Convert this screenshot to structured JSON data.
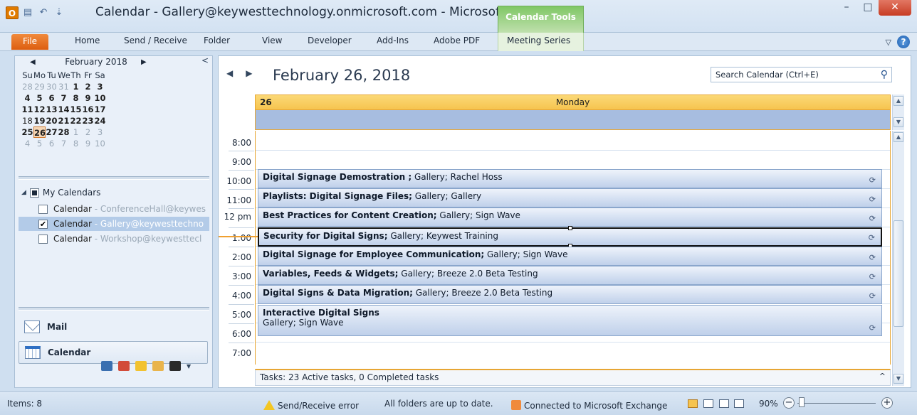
{
  "window": {
    "title": "Calendar - Gallery@keywesttechnology.onmicrosoft.com - Microsof...",
    "context_tab": "Calendar Tools",
    "controls": {
      "minimize": "–",
      "maximize": "□",
      "close": "✕"
    }
  },
  "ribbon": {
    "file": "File",
    "tabs": [
      "Home",
      "Send / Receive",
      "Folder",
      "View",
      "Developer",
      "Add-Ins",
      "Adobe PDF",
      "Meeting Series"
    ]
  },
  "minical": {
    "month_label": "February 2018",
    "weekdays": [
      "Su",
      "Mo",
      "Tu",
      "We",
      "Th",
      "Fr",
      "Sa"
    ],
    "weeks": [
      [
        "28",
        "29",
        "30",
        "31",
        "1",
        "2",
        "3"
      ],
      [
        "4",
        "5",
        "6",
        "7",
        "8",
        "9",
        "10"
      ],
      [
        "11",
        "12",
        "13",
        "14",
        "15",
        "16",
        "17"
      ],
      [
        "18",
        "19",
        "20",
        "21",
        "22",
        "23",
        "24"
      ],
      [
        "25",
        "26",
        "27",
        "28",
        "1",
        "2",
        "3"
      ],
      [
        "4",
        "5",
        "6",
        "7",
        "8",
        "9",
        "10"
      ]
    ],
    "today": "26"
  },
  "my_calendars": {
    "group_label": "My Calendars",
    "items": [
      {
        "name": "Calendar",
        "owner": " - ConferenceHall@keywes",
        "checked": false
      },
      {
        "name": "Calendar",
        "owner": " - Gallery@keywesttechno",
        "checked": true
      },
      {
        "name": "Calendar",
        "owner": " - Workshop@keywesttecl",
        "checked": false
      }
    ]
  },
  "nav_buttons": {
    "mail": "Mail",
    "calendar": "Calendar"
  },
  "calendar": {
    "date_title": "February 26, 2018",
    "search_placeholder": "Search Calendar (Ctrl+E)",
    "day_number": "26",
    "day_name": "Monday",
    "time_labels": [
      "8:00",
      "9:00",
      "10:00",
      "11:00",
      "12 pm",
      "1:00",
      "2:00",
      "3:00",
      "4:00",
      "5:00",
      "6:00",
      "7:00"
    ],
    "appointments": [
      {
        "title": "Digital Signage Demostration ;",
        "detail": " Gallery; Rachel Hoss"
      },
      {
        "title": "Playlists: Digital Signage Files;",
        "detail": " Gallery; Gallery"
      },
      {
        "title": "Best Practices for Content Creation;",
        "detail": " Gallery; Sign Wave"
      },
      {
        "title": "Security for Digital Signs;",
        "detail": " Gallery; Keywest Training"
      },
      {
        "title": "Digital Signage for Employee Communication;",
        "detail": " Gallery; Sign Wave"
      },
      {
        "title": "Variables, Feeds & Widgets;",
        "detail": " Gallery; Breeze 2.0 Beta Testing"
      },
      {
        "title": "Digital Signs & Data Migration;",
        "detail": " Gallery; Breeze 2.0 Beta Testing"
      },
      {
        "title": "Interactive Digital Signs",
        "detail": "Gallery; Sign Wave"
      }
    ],
    "tasks_text": "Tasks: 23 Active tasks, 0 Completed tasks"
  },
  "status": {
    "items": "Items: 8",
    "send_receive": "Send/Receive error",
    "folders": "All folders are up to date.",
    "exchange": "Connected to Microsoft Exchange",
    "zoom": "90%"
  }
}
